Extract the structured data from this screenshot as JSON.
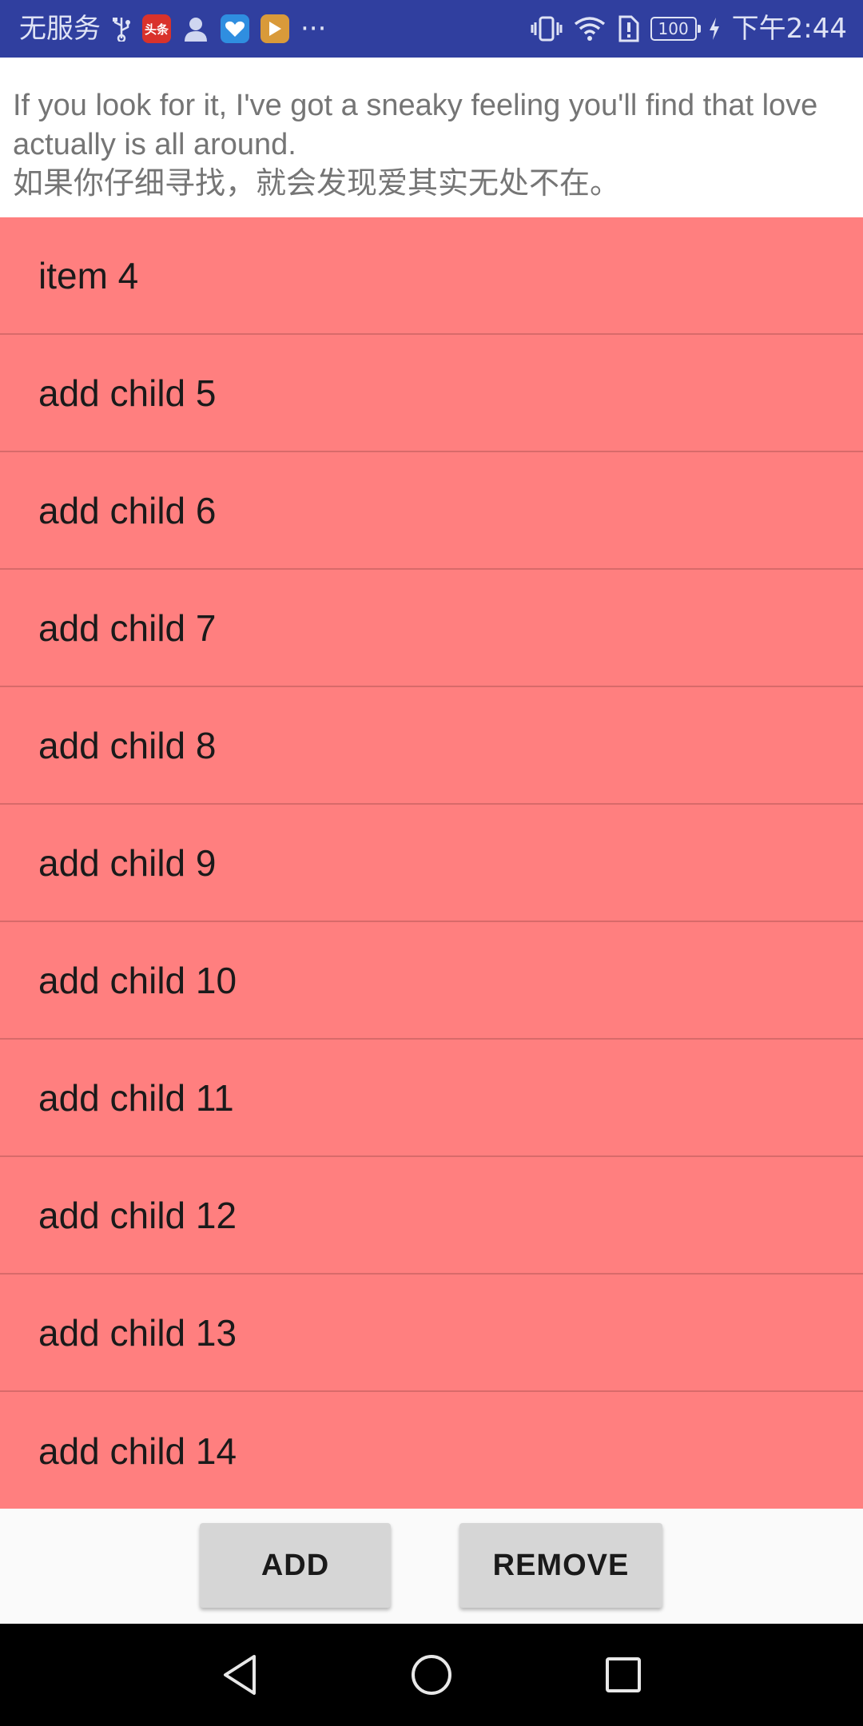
{
  "status_bar": {
    "carrier": "无服务",
    "app_badges": [
      {
        "name": "toutiao-app-icon",
        "text": "头条",
        "color": "#d9322b"
      },
      {
        "name": "blue-app-icon",
        "text": "",
        "color": "#2f8ee0"
      },
      {
        "name": "video-app-icon",
        "text": "",
        "color": "#d99a3a"
      }
    ],
    "more": "···",
    "battery_level": "100",
    "time": "下午2:44",
    "background_color": "#303f9f"
  },
  "description": {
    "english": "If you look for it, I've got a sneaky feeling you'll find that love actually is all around.",
    "chinese": "如果你仔细寻找，就会发现爱其实无处不在。"
  },
  "list": {
    "background_color": "#ff7f7f",
    "items": [
      "item 4",
      "add child 5",
      "add child 6",
      "add child 7",
      "add child 8",
      "add child 9",
      "add child 10",
      "add child 11",
      "add child 12",
      "add child 13",
      "add child 14"
    ]
  },
  "buttons": {
    "add_label": "ADD",
    "remove_label": "REMOVE"
  },
  "nav_bar": {
    "icons": [
      "back-icon",
      "home-icon",
      "recent-apps-icon"
    ]
  }
}
